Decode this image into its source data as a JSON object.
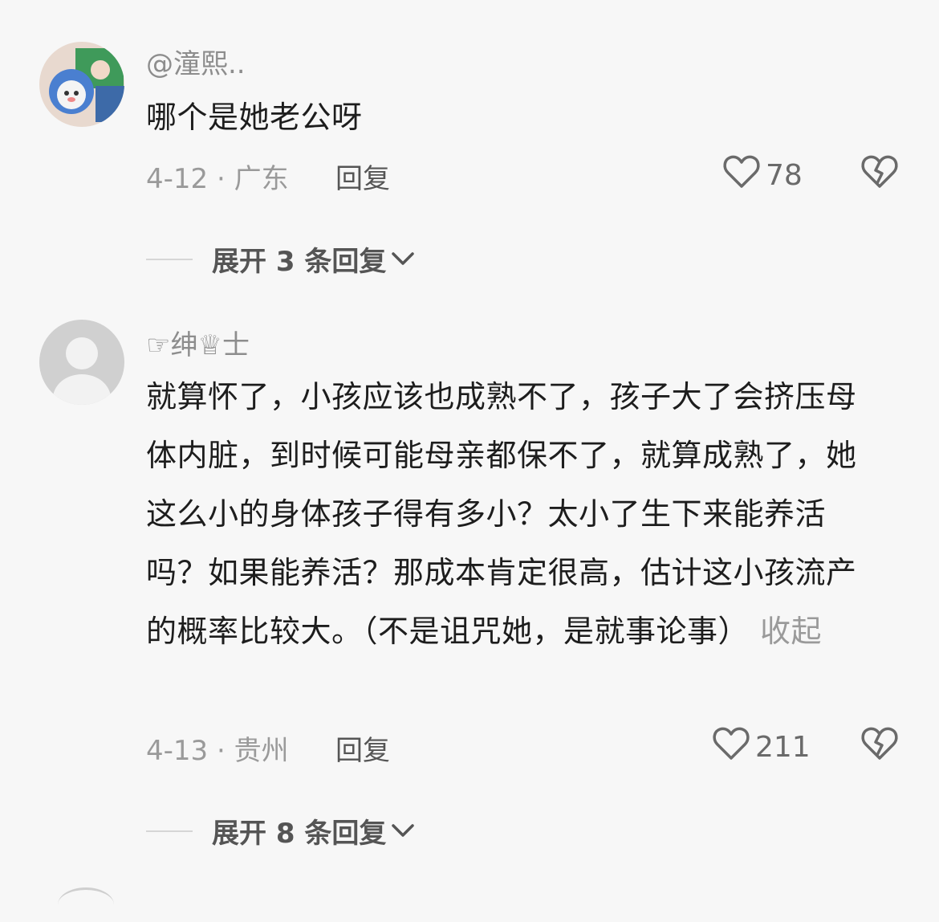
{
  "comments": [
    {
      "username": "@潼熙..",
      "text": "哪个是她老公呀",
      "date_location": "4-12 · 广东",
      "reply_label": "回复",
      "likes": "78",
      "expand_label": "展开 3 条回复"
    },
    {
      "username": "☞绅♕士",
      "text": "就算怀了，小孩应该也成熟不了，孩子大了会挤压母体内脏，到时候可能母亲都保不了，就算成熟了，她这么小的身体孩子得有多小？太小了生下来能养活吗？如果能养活？那成本肯定很高，估计这小孩流产的概率比较大。（不是诅咒她，是就事论事）",
      "collapse_label": "收起",
      "date_location": "4-13 · 贵州",
      "reply_label": "回复",
      "likes": "211",
      "expand_label": "展开 8 条回复"
    }
  ],
  "icons": {
    "like": "heart-outline-icon",
    "dislike": "broken-heart-icon",
    "expand": "chevron-down-icon"
  }
}
